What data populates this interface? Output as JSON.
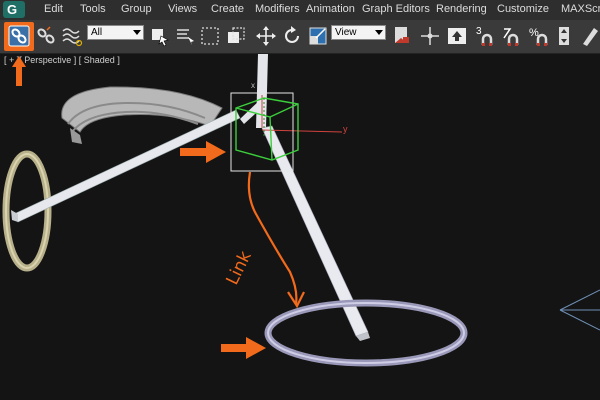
{
  "menubar": {
    "logo_letter": "G",
    "items": [
      "Edit",
      "Tools",
      "Group",
      "Views",
      "Create",
      "Modifiers",
      "Animation",
      "Graph Editors",
      "Rendering",
      "Customize",
      "MAXScri"
    ]
  },
  "toolbar": {
    "selection_filter": "All",
    "coordinate_system": "View",
    "snap_toggle_number": "3",
    "percent_symbol": "%"
  },
  "viewport": {
    "label": "[ + ][ Perspective ] [ Shaded ]",
    "axis_x_label": "x",
    "axis_y_label": "y",
    "annotation_text": "Link"
  },
  "colors": {
    "highlight": "#f26a1b",
    "selection": "#3ccf3c",
    "viewport_bg": "#141414",
    "toolbar_bg": "#3a3a3a"
  }
}
